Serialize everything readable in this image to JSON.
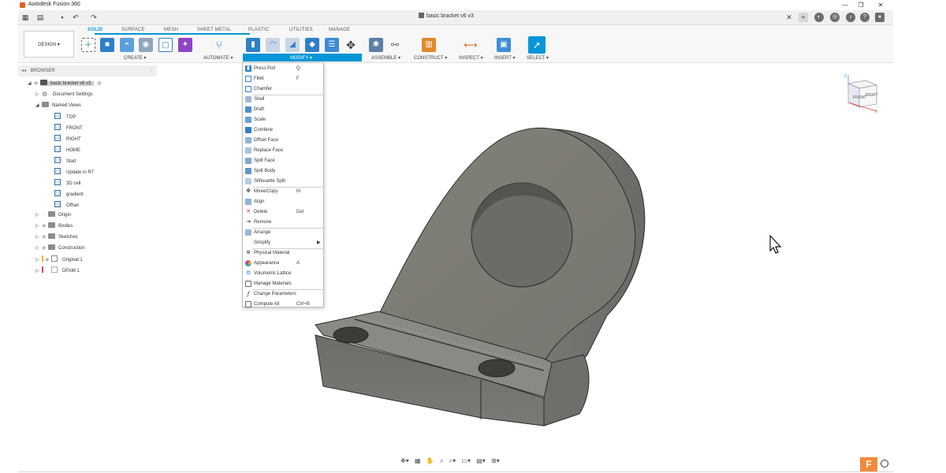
{
  "window": {
    "app_title": "Autodesk Fusion 360",
    "minimize": "—",
    "restore": "❐",
    "close": "✕"
  },
  "quick_access": {
    "doc_title": "basic bracket v6 v3",
    "tab_close": "✕",
    "new_tab": "+"
  },
  "ribbon": {
    "workspace": "DESIGN ▾",
    "tabs": [
      "SOLID",
      "SURFACE",
      "MESH",
      "SHEET METAL",
      "PLASTIC",
      "UTILITIES",
      "MANAGE"
    ],
    "groups": [
      "CREATE ▾",
      "AUTOMATE ▾",
      "MODIFY ▾",
      "ASSEMBLE ▾",
      "CONSTRUCT ▾",
      "INSPECT ▾",
      "INSERT ▾",
      "SELECT ▾"
    ],
    "accent": "#0696d7"
  },
  "browser": {
    "header": "BROWSER",
    "root": "basic bracket v6 v3",
    "items": {
      "document_settings": "Document Settings",
      "named_views": "Named Views",
      "views": [
        "TOP",
        "FRONT",
        "RIGHT",
        "HOME",
        "Start",
        "Update in R7",
        "3D cell",
        "gradient",
        "Offset"
      ],
      "origin": "Origin",
      "bodies": "Bodies",
      "sketches": "Sketches",
      "construction": "Construction",
      "original": "Original:1",
      "dfam": "DFAM:1"
    }
  },
  "modify_menu": [
    {
      "label": "Press Pull",
      "key": "Q"
    },
    {
      "label": "Fillet",
      "key": "F"
    },
    {
      "label": "Chamfer",
      "key": ""
    },
    {
      "label": "Shell",
      "key": ""
    },
    {
      "label": "Draft",
      "key": ""
    },
    {
      "label": "Scale",
      "key": ""
    },
    {
      "label": "Combine",
      "key": ""
    },
    {
      "label": "Offset Face",
      "key": ""
    },
    {
      "label": "Replace Face",
      "key": ""
    },
    {
      "label": "Split Face",
      "key": ""
    },
    {
      "label": "Split Body",
      "key": ""
    },
    {
      "label": "Silhouette Split",
      "key": ""
    },
    {
      "label": "Move/Copy",
      "key": "M"
    },
    {
      "label": "Align",
      "key": ""
    },
    {
      "label": "Delete",
      "key": "Del"
    },
    {
      "label": "Remove",
      "key": ""
    },
    {
      "label": "Arrange",
      "key": ""
    },
    {
      "label": "Simplify",
      "key": ""
    },
    {
      "label": "Physical Material",
      "key": ""
    },
    {
      "label": "Appearance",
      "key": "A"
    },
    {
      "label": "Volumetric Lattice",
      "key": ""
    },
    {
      "label": "Manage Materials",
      "key": ""
    },
    {
      "label": "Change Parameters",
      "key": ""
    },
    {
      "label": "Compute All",
      "key": "Ctrl+B"
    }
  ],
  "viewcube": {
    "front": "FRONT",
    "right": "RIGHT",
    "z": "Z",
    "x": "X"
  },
  "status": {
    "badge": "F"
  }
}
